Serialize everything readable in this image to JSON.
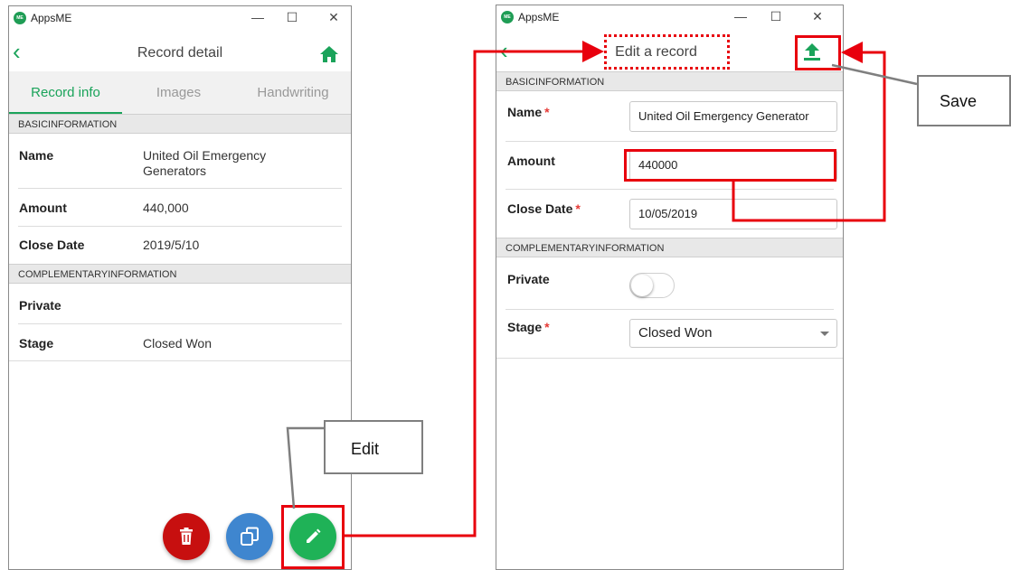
{
  "left_window": {
    "app_name": "AppsME",
    "logo_text": "ME",
    "title": "Record detail",
    "tabs": [
      "Record info",
      "Images",
      "Handwriting"
    ],
    "active_tab": "Record info",
    "section_basic": "BASICINFORMATION",
    "fields": [
      {
        "label": "Name",
        "value": "United Oil Emergency Generators"
      },
      {
        "label": "Amount",
        "value": "440,000"
      },
      {
        "label": "Close Date",
        "value": "2019/5/10"
      }
    ],
    "section_complementary": "COMPLEMENTARYINFORMATION",
    "fields2": [
      {
        "label": "Private",
        "value": ""
      },
      {
        "label": "Stage",
        "value": "Closed Won"
      }
    ],
    "fabs": [
      {
        "name": "delete",
        "color": "#c70f0f",
        "icon": "trash-icon"
      },
      {
        "name": "copy",
        "color": "#3f86cf",
        "icon": "copy-icon"
      },
      {
        "name": "edit",
        "color": "#1fb257",
        "icon": "pencil-icon"
      }
    ]
  },
  "right_window": {
    "app_name": "AppsME",
    "logo_text": "ME",
    "title": "Edit a record",
    "section_basic": "BASICINFORMATION",
    "fields": [
      {
        "label": "Name",
        "required": "*",
        "value": "United Oil Emergency Generator"
      },
      {
        "label": "Amount",
        "required": "",
        "value": "440000"
      },
      {
        "label": "Close Date",
        "required": "*",
        "value": "10/05/2019"
      }
    ],
    "section_complementary": "COMPLEMENTARYINFORMATION",
    "private": {
      "label": "Private",
      "checked": false
    },
    "stage": {
      "label": "Stage",
      "required": "*",
      "value": "Closed Won"
    },
    "save_icon": "upload-icon"
  },
  "window_controls": {
    "minimize": "—",
    "maximize": "☐",
    "close": "✕"
  },
  "annotations": {
    "edit_label": "Edit",
    "save_label": "Save"
  },
  "colors": {
    "accent": "#1aa35a",
    "annotation": "#e8000d",
    "required": "#e53935"
  }
}
